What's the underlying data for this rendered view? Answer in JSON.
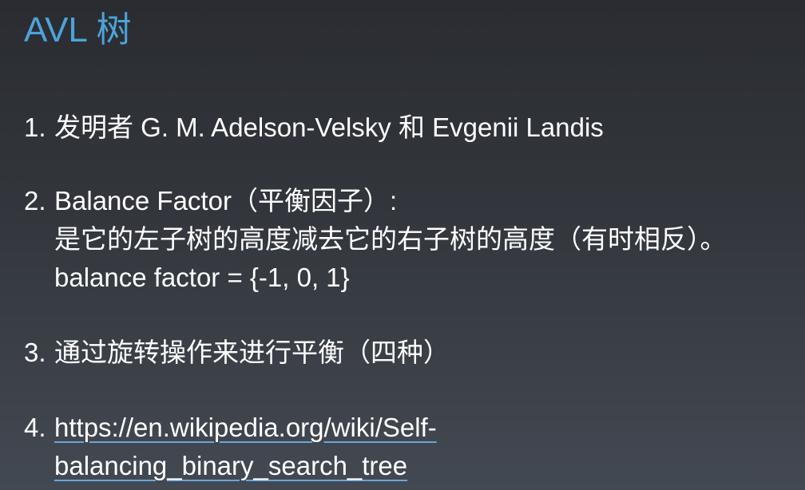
{
  "slide": {
    "title": "AVL 树",
    "accent_color": "#4da3d9",
    "items": [
      {
        "number": "1.",
        "lines": [
          "发明者 G. M. Adelson-Velsky 和 Evgenii Landis"
        ]
      },
      {
        "number": "2.",
        "lines": [
          "Balance Factor（平衡因子）:",
          "是它的左子树的高度减去它的右子树的高度（有时相反）。",
          "balance factor = {-1, 0, 1}"
        ]
      },
      {
        "number": "3.",
        "lines": [
          "通过旋转操作来进行平衡（四种）"
        ]
      },
      {
        "number": "4.",
        "lines": [
          "https://en.wikipedia.org/wiki/Self-",
          "balancing_binary_search_tree"
        ]
      }
    ]
  }
}
